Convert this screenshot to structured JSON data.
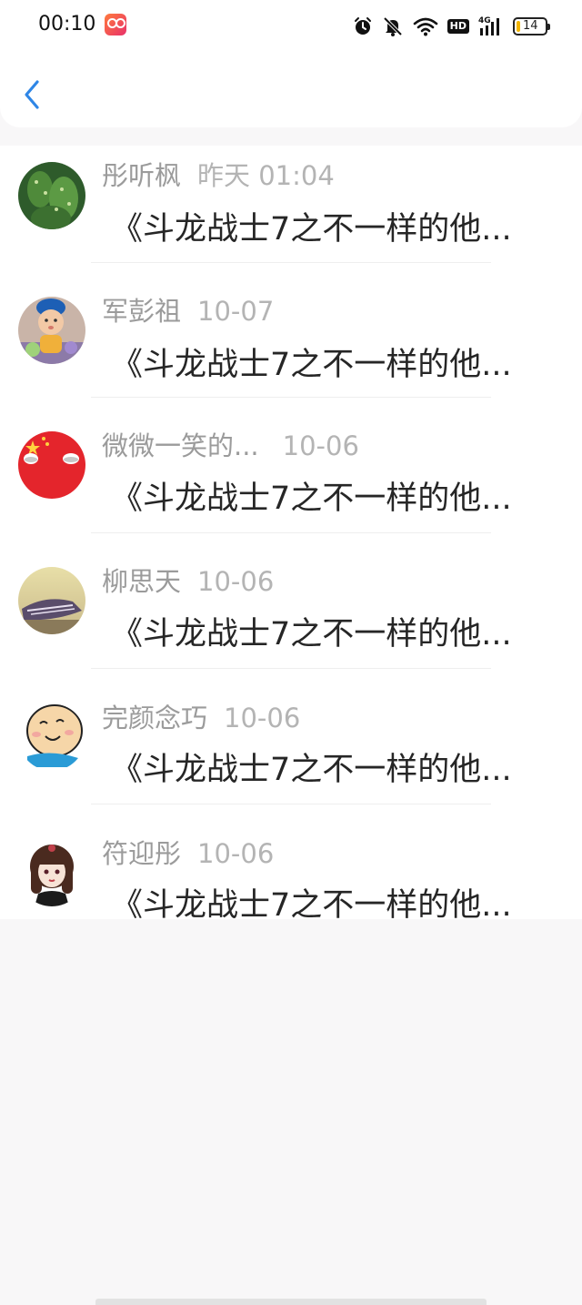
{
  "status_bar": {
    "time": "00:10",
    "network": "4G",
    "hd": "HD",
    "battery_level": "14",
    "battery_percent": 14
  },
  "header": {
    "back_icon": "chevron-left-icon"
  },
  "colors": {
    "accent": "#2f86e6",
    "name_gray": "#9b9b9b",
    "message_text": "#262626",
    "background": "#f8f7f8"
  },
  "items": [
    {
      "name": "彤听枫",
      "date": "昨天 01:04",
      "message": "《斗龙战士7之不一样的他..."
    },
    {
      "name": "军彭祖",
      "date": "10-07",
      "message": "《斗龙战士7之不一样的他..."
    },
    {
      "name": "微微一笑的...",
      "date": "10-06",
      "message": "《斗龙战士7之不一样的他..."
    },
    {
      "name": "柳思天",
      "date": "10-06",
      "message": "《斗龙战士7之不一样的他..."
    },
    {
      "name": "完颜念巧",
      "date": "10-06",
      "message": "《斗龙战士7之不一样的他..."
    },
    {
      "name": "符迎彤",
      "date": "10-06",
      "message": "《斗龙战士7之不一样的他..."
    }
  ]
}
